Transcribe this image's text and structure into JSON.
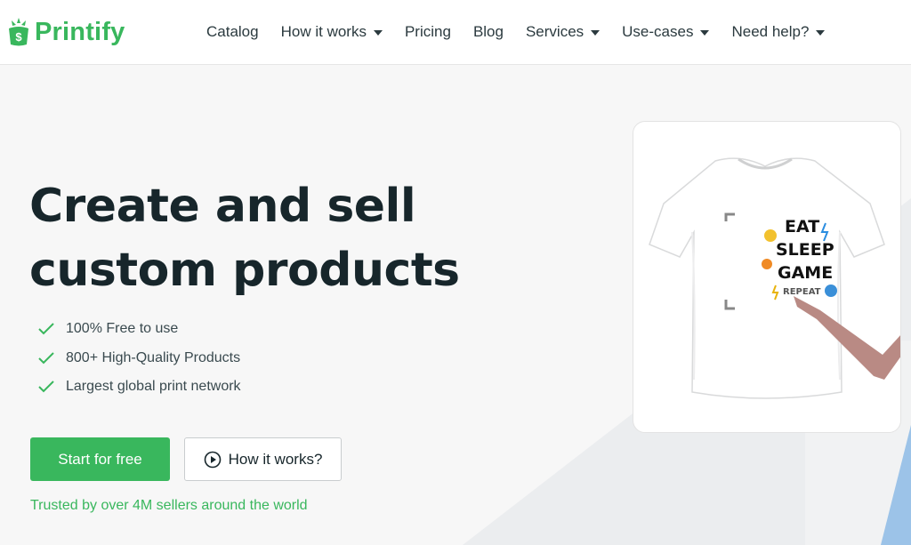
{
  "brand": {
    "name": "Printify",
    "logo_icon": "printify-logo-icon",
    "accent_color": "#39b75d"
  },
  "nav": {
    "items": [
      {
        "label": "Catalog",
        "has_dropdown": false
      },
      {
        "label": "How it works",
        "has_dropdown": true
      },
      {
        "label": "Pricing",
        "has_dropdown": false
      },
      {
        "label": "Blog",
        "has_dropdown": false
      },
      {
        "label": "Services",
        "has_dropdown": true
      },
      {
        "label": "Use-cases",
        "has_dropdown": true
      },
      {
        "label": "Need help?",
        "has_dropdown": true
      }
    ]
  },
  "hero": {
    "title_line1": "Create and sell",
    "title_line2": "custom products",
    "features": [
      "100% Free to use",
      "800+ High-Quality Products",
      "Largest global print network"
    ],
    "primary_cta": "Start for free",
    "secondary_cta": "How it works?",
    "trusted_text": "Trusted by over 4M sellers around the world"
  },
  "product_preview": {
    "shirt_print_text": [
      "EAT",
      "SLEEP",
      "GAME",
      "REPEAT"
    ],
    "shirt_color": "#ffffff",
    "arm_color": "#b98a84"
  }
}
